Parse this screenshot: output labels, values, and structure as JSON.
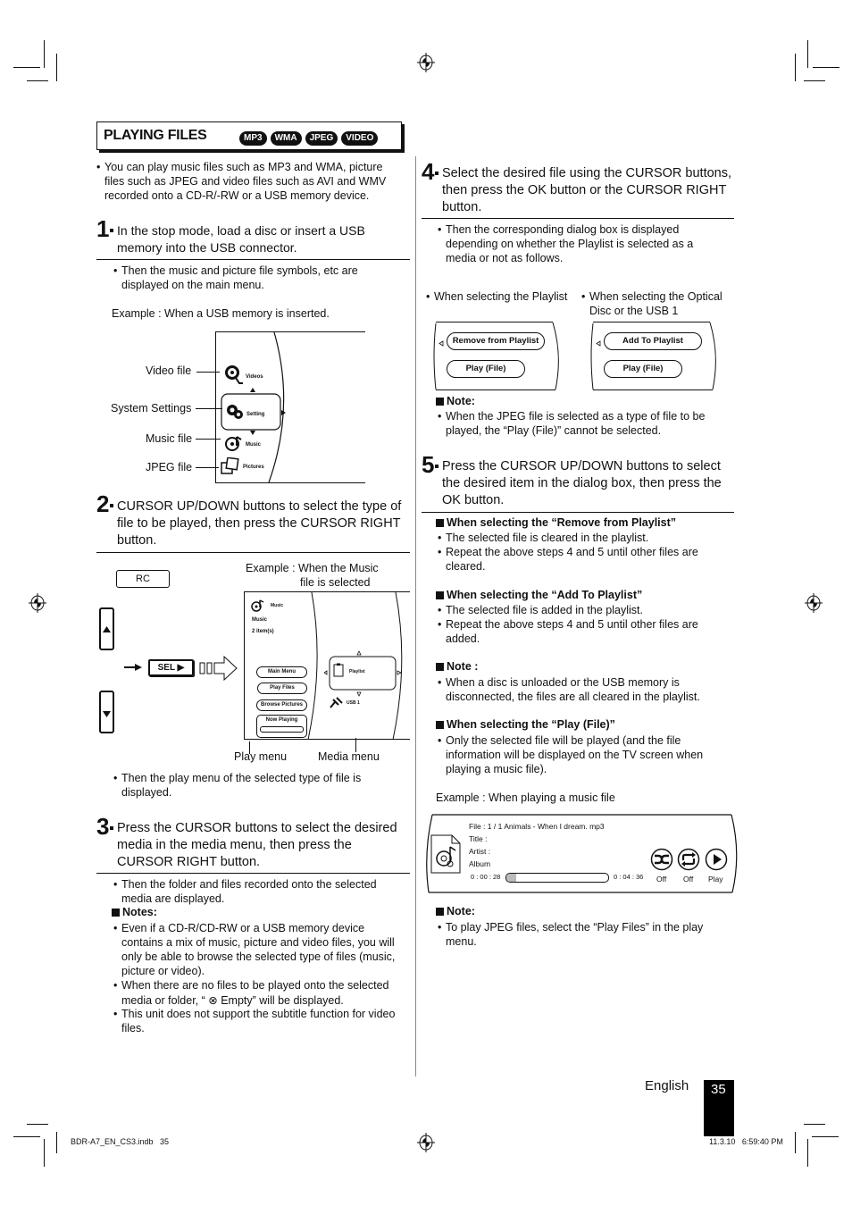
{
  "section": {
    "title": "PLAYING FILES",
    "badges": [
      "MP3",
      "WMA",
      "JPEG",
      "VIDEO"
    ]
  },
  "intro": {
    "bullet_lines": [
      "You can play music files such as MP3 and WMA, picture",
      "files such as JPEG and video files such as AVI and WMV",
      "recorded onto a CD-R/-RW or a USB memory device."
    ]
  },
  "steps": [
    {
      "number": "1",
      "lines": [
        "In the stop mode, load a disc or insert a USB",
        "memory into the USB connector."
      ],
      "bullet_lines": [
        "Then the music and picture file symbols, etc are",
        "displayed on the main menu."
      ],
      "example": "Example : When a USB memory is inserted."
    },
    {
      "number": "2",
      "lines": [
        "CURSOR UP/DOWN buttons to select the type of",
        "file to be played, then press the CURSOR RIGHT",
        "button."
      ],
      "example_lines": [
        "Example : When the Music",
        "file is selected"
      ],
      "bullet_lines": [
        "Then the play menu of the selected type of file is",
        "displayed."
      ]
    },
    {
      "number": "3",
      "lines": [
        "Press the CURSOR buttons to select the desired",
        "media in the media menu, then press the",
        "CURSOR RIGHT button."
      ],
      "bullet_lines": [
        "Then the folder and files recorded onto the selected",
        "media are displayed."
      ],
      "notes_heading": "Notes:",
      "notes": [
        [
          "Even if a CD-R/CD-RW or a USB memory device",
          "contains a mix of music, picture and video files, you will",
          "only be able to browse the selected type of files (music,",
          "picture or video)."
        ],
        [
          "When there are no files to be played onto the selected",
          "media or folder, “ ⊗ Empty” will be displayed."
        ],
        [
          "This unit does not support the subtitle function for video",
          "files."
        ]
      ]
    },
    {
      "number": "4",
      "lines": [
        "Select the desired file using the CURSOR buttons,",
        "then press the OK button or the CURSOR RIGHT",
        "button."
      ],
      "bullet_lines": [
        "Then the corresponding dialog box is displayed",
        "depending on whether the Playlist is selected as a",
        "media or not as follows."
      ],
      "case_playlist": "When selecting the Playlist",
      "case_optical_lines": [
        "When selecting the Optical",
        "Disc or the USB 1"
      ],
      "note_heading": "Note:",
      "note_lines": [
        "When the JPEG file is selected as a type of file to be",
        "played, the “Play (File)” cannot be selected."
      ]
    },
    {
      "number": "5",
      "lines": [
        "Press the CURSOR UP/DOWN buttons to select",
        "the desired item in the dialog box, then press the",
        "OK button."
      ],
      "remove": {
        "heading": "When selecting the “Remove from Playlist”",
        "bullets": [
          [
            "The selected file is cleared in the playlist."
          ],
          [
            "Repeat the above steps 4 and 5 until other files are",
            "cleared."
          ]
        ]
      },
      "add": {
        "heading": "When selecting the “Add To Playlist”",
        "bullets": [
          [
            "The selected file is added in the playlist."
          ],
          [
            "Repeat the above steps 4 and 5 until other files are",
            "added."
          ]
        ]
      },
      "note": {
        "heading": "Note :",
        "lines": [
          "When a disc is unloaded or the USB memory is",
          "disconnected, the files are all cleared in the playlist."
        ]
      },
      "play": {
        "heading": "When selecting the “Play (File)”",
        "lines": [
          "Only the selected file will be played (and the file",
          "information will be displayed on the TV screen when",
          "playing a music file)."
        ]
      },
      "example": "Example : When playing a music file",
      "final_note": {
        "heading": "Note:",
        "lines": [
          "To play JPEG files, select the “Play Files” in the play",
          "menu."
        ]
      }
    }
  ],
  "main_menu_diagram": {
    "labels": [
      "Video file",
      "System Settings",
      "Music file",
      "JPEG file"
    ],
    "items": [
      {
        "icon": "film-reel-icon",
        "label": "Videos"
      },
      {
        "icon": "gears-icon",
        "label": "Setting"
      },
      {
        "icon": "music-disc-icon",
        "label": "Music"
      },
      {
        "icon": "pictures-icon",
        "label": "Pictures"
      }
    ]
  },
  "remote": {
    "rc_label": "RC",
    "sel_label": "SEL ▶"
  },
  "play_menu_diagram": {
    "header_label": "Music",
    "folder": "Music",
    "count": "2 item(s)",
    "buttons": [
      "Main Menu",
      "Play Files",
      "Browse Pictures",
      "Now Playing"
    ],
    "media_selected": "Playlist",
    "media_other": "USB 1",
    "caption_play": "Play menu",
    "caption_media": "Media menu"
  },
  "dialogs": {
    "playlist": [
      "Remove from Playlist",
      "Play (File)"
    ],
    "optical": [
      "Add To Playlist",
      "Play (File)"
    ]
  },
  "now_playing": {
    "file": "File : 1 / 1 Animals - When I dream. mp3",
    "title": "Title :",
    "artist": "Artist :",
    "album": "Album",
    "elapsed": "0 : 00 : 28",
    "total": "0 : 04 : 36",
    "progress_fraction": 0.1,
    "controls": [
      {
        "icon": "shuffle-icon",
        "label": "Off"
      },
      {
        "icon": "repeat-icon",
        "label": "Off"
      },
      {
        "icon": "play-icon",
        "label": "Play"
      }
    ]
  },
  "footer": {
    "language": "English",
    "page_number": "35",
    "file_info": "BDR-A7_EN_CS3.indb   35",
    "timestamp": "11.3.10   6:59:40 PM"
  }
}
